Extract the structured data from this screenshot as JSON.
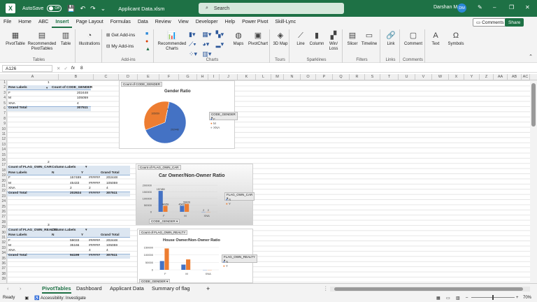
{
  "titlebar": {
    "app_letter": "X",
    "autosave_label": "AutoSave",
    "autosave_state": "Off",
    "title": "Applicant Data.xlsm",
    "search_placeholder": "Search",
    "user_name": "Darshan M",
    "user_initials": "DM"
  },
  "menu": [
    "File",
    "Home",
    "ABC",
    "Insert",
    "Page Layout",
    "Formulas",
    "Data",
    "Review",
    "View",
    "Developer",
    "Help",
    "Power Pivot",
    "Skill-Lync"
  ],
  "menu_active": "Insert",
  "comments_label": "Comments",
  "share_label": "Share",
  "ribbon": {
    "pivottable": "PivotTable",
    "recommended_pivottables": "Recommended PivotTables",
    "table": "Table",
    "tables_group": "Tables",
    "illustrations": "Illustrations",
    "get_addins": "Get Add-ins",
    "my_addins": "My Add-ins",
    "addins_group": "Add-ins",
    "recommended_charts": "Recommended Charts",
    "maps": "Maps",
    "pivotchart": "PivotChart",
    "charts_group": "Charts",
    "map3d": "3D Map",
    "tours_group": "Tours",
    "line": "Line",
    "column": "Column",
    "winloss": "Win/ Loss",
    "sparklines_group": "Sparklines",
    "slicer": "Slicer",
    "timeline": "Timeline",
    "filters_group": "Filters",
    "link": "Link",
    "links_group": "Links",
    "comment": "Comment",
    "comments_group": "Comments",
    "text": "Text",
    "symbols": "Symbols"
  },
  "formula": {
    "namebox": "A126",
    "value": "8"
  },
  "columns": [
    "A",
    "B",
    "C",
    "D",
    "E",
    "F",
    "G",
    "H",
    "I",
    "J",
    "K",
    "L",
    "M",
    "N",
    "O",
    "P",
    "Q",
    "R",
    "S",
    "T",
    "U",
    "V",
    "W",
    "X",
    "Y",
    "Z",
    "AA",
    "AB",
    "AC"
  ],
  "pivot1": {
    "num": "1",
    "row_labels": "Row Labels",
    "col": "Count of CODE_GENDER",
    "rows": [
      [
        "F",
        "202448"
      ],
      [
        "M",
        "105059"
      ],
      [
        "XNA",
        "4"
      ]
    ],
    "grand": [
      "Grand Total",
      "307511"
    ]
  },
  "pivot2": {
    "num": "2",
    "title": "Count of FLAG_OWN_CAR",
    "col_labels": "Column Labels",
    "row_labels": "Row Labels",
    "n": "N",
    "y": "Y",
    "grand_total": "Grand Total",
    "rows": [
      [
        "F",
        "157489",
        "######",
        "",
        "202448"
      ],
      [
        "M",
        "45433",
        "######",
        "",
        "105059"
      ],
      [
        "XNA",
        "2",
        "2",
        "",
        "4"
      ]
    ],
    "grand": [
      "Grand Total",
      "202924",
      "######",
      "",
      "307511"
    ]
  },
  "pivot3": {
    "num": "3",
    "title": "Count of FLAG_OWN_REALTY",
    "col_labels": "Column Labels",
    "row_labels": "Row Labels",
    "n": "N",
    "y": "Y",
    "grand_total": "Grand Total",
    "rows": [
      [
        "F",
        "59033",
        "######",
        "",
        "202448"
      ],
      [
        "M",
        "35166",
        "######",
        "",
        "105059"
      ],
      [
        "XNA",
        "",
        "4",
        "",
        "4"
      ]
    ],
    "grand": [
      "Grand Total",
      "94199",
      "######",
      "",
      "307511"
    ]
  },
  "chart1": {
    "field": "Count of CODE_GENDER",
    "title": "Gender Ratio",
    "legend_field": "CODE_GENDER",
    "legend": [
      "F",
      "M",
      "XNA"
    ],
    "labels": [
      "202448",
      "105059",
      "4"
    ]
  },
  "chart2": {
    "field": "Count of FLAG_OWN_CAR",
    "title": "Car Owner/Non-Owner Ratio",
    "legend_field": "FLAG_OWN_CAR",
    "legend": [
      "N",
      "Y"
    ],
    "axis_field": "CODE_GENDER",
    "yticks": [
      "200000",
      "150000",
      "100000",
      "50000",
      "0"
    ]
  },
  "chart3": {
    "field": "Count of FLAG_OWN_REALTY",
    "title": "House Owner/Non-Owner Ratio",
    "legend_field": "FLAG_OWN_REALTY",
    "legend": [
      "N",
      "Y"
    ],
    "axis_field": "CODE_GENDER",
    "yticks": [
      "150000",
      "100000",
      "50000",
      "0"
    ]
  },
  "chart_data": [
    {
      "type": "pie",
      "title": "Gender Ratio",
      "categories": [
        "F",
        "M",
        "XNA"
      ],
      "values": [
        202448,
        105059,
        4
      ],
      "colors": [
        "#4472c4",
        "#ed7d31",
        "#a5a5a5"
      ]
    },
    {
      "type": "bar",
      "title": "Car Owner/Non-Owner Ratio",
      "categories": [
        "F",
        "M",
        "XNA"
      ],
      "series": [
        {
          "name": "N",
          "values": [
            157489,
            45433,
            2
          ]
        },
        {
          "name": "Y",
          "values": [
            44959,
            59626,
            2
          ]
        }
      ],
      "ylim": [
        0,
        200000
      ],
      "data_labels": [
        "157489",
        "44959",
        "45433",
        "59626",
        "2",
        "2"
      ]
    },
    {
      "type": "bar",
      "title": "House Owner/Non-Owner Ratio",
      "categories": [
        "F",
        "M",
        "XNA"
      ],
      "series": [
        {
          "name": "N",
          "values": [
            59033,
            35166,
            0
          ]
        },
        {
          "name": "Y",
          "values": [
            143415,
            69893,
            4
          ]
        }
      ],
      "ylim": [
        0,
        150000
      ]
    }
  ],
  "sheets": [
    "PivotTables",
    "Dashboard",
    "Applicant Data",
    "Summary of flag"
  ],
  "sheet_active": "PivotTables",
  "status": {
    "ready": "Ready",
    "accessibility": "Accessibility: Investigate",
    "zoom": "70%"
  }
}
